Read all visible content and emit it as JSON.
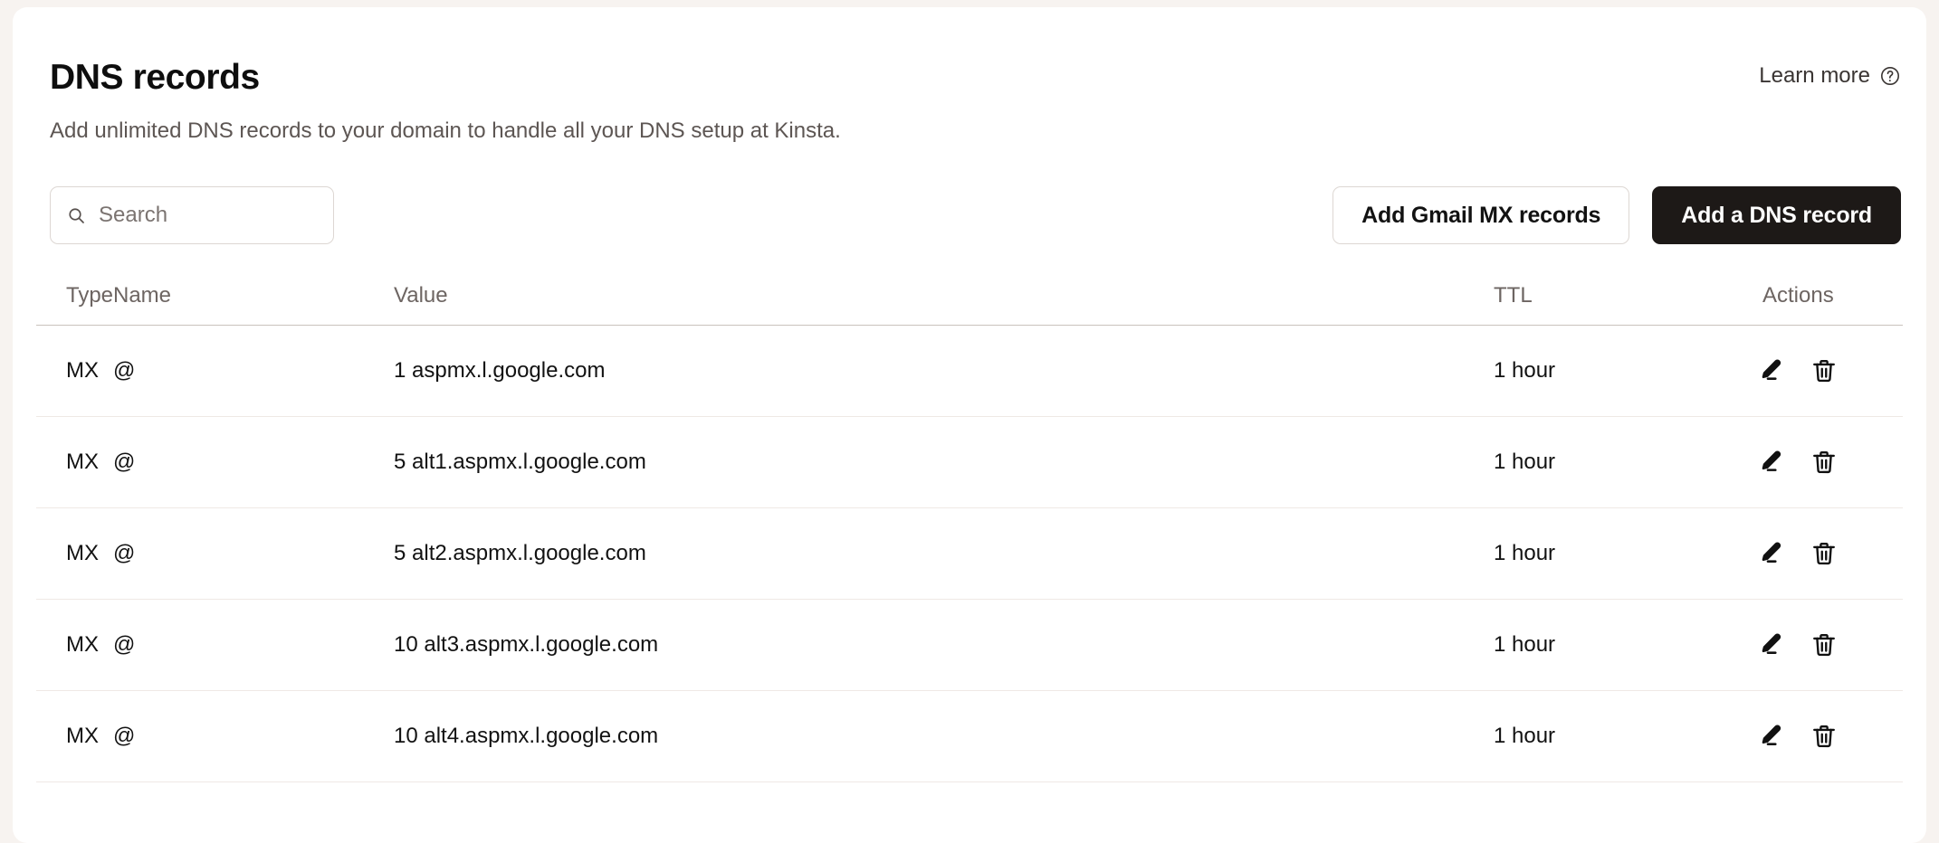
{
  "header": {
    "title": "DNS records",
    "subtitle": "Add unlimited DNS records to your domain to handle all your DNS setup at Kinsta.",
    "learn_more_label": "Learn more",
    "learn_more_icon": "help-circle-icon"
  },
  "search": {
    "placeholder": "Search",
    "value": "",
    "icon": "search-icon"
  },
  "buttons": {
    "secondary_label": "Add Gmail MX records",
    "primary_label": "Add a DNS record"
  },
  "table": {
    "columns": [
      "Type",
      "Name",
      "Value",
      "TTL",
      "Actions"
    ],
    "rows": [
      {
        "type": "MX",
        "name": "@",
        "value": "1 aspmx.l.google.com",
        "ttl": "1 hour"
      },
      {
        "type": "MX",
        "name": "@",
        "value": "5 alt1.aspmx.l.google.com",
        "ttl": "1 hour"
      },
      {
        "type": "MX",
        "name": "@",
        "value": "5 alt2.aspmx.l.google.com",
        "ttl": "1 hour"
      },
      {
        "type": "MX",
        "name": "@",
        "value": "10 alt3.aspmx.l.google.com",
        "ttl": "1 hour"
      },
      {
        "type": "MX",
        "name": "@",
        "value": "10 alt4.aspmx.l.google.com",
        "ttl": "1 hour"
      }
    ],
    "row_actions": {
      "edit_icon": "pencil-icon",
      "delete_icon": "trash-icon"
    }
  },
  "colors": {
    "page_background": "#f7f3f0",
    "card_background": "#ffffff",
    "primary_button": "#1d1917",
    "text_primary": "#121212",
    "text_muted": "#6d6562",
    "divider": "#efe9e5"
  }
}
